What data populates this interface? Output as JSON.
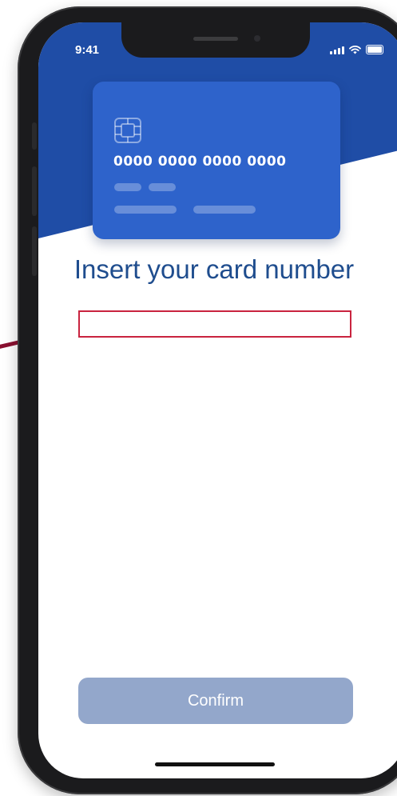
{
  "status_bar": {
    "time": "9:41",
    "icons": [
      "signal-icon",
      "wifi-icon",
      "battery-icon"
    ]
  },
  "card": {
    "number_placeholder": "0000 0000 0000 0000",
    "icons": [
      "chip-icon"
    ]
  },
  "form": {
    "title": "Insert your card number",
    "card_input_value": "",
    "confirm_label": "Confirm"
  },
  "colors": {
    "header_blue": "#1f4da6",
    "card_blue": "#2e63cb",
    "title_blue": "#1f4d8e",
    "input_border": "#c9243f",
    "confirm_bg": "#93a7cb"
  }
}
